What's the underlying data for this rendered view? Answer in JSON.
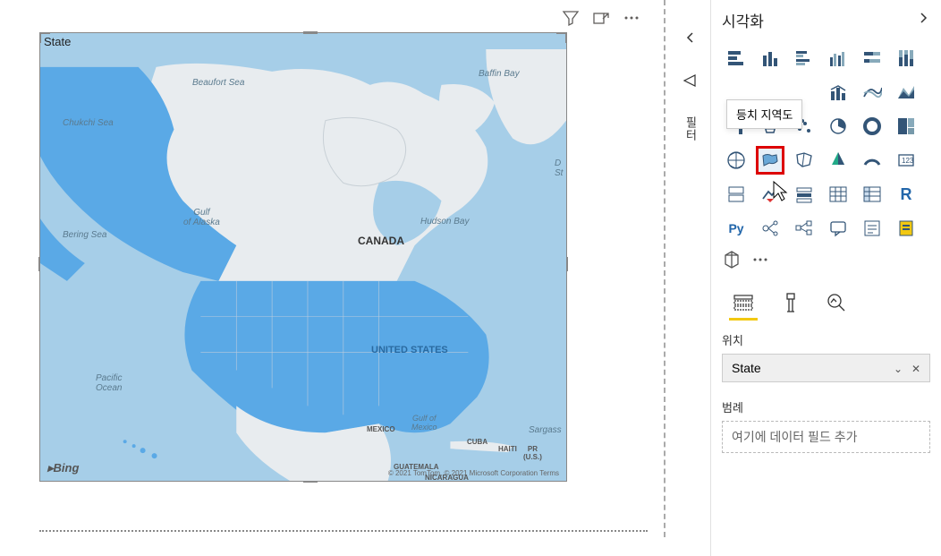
{
  "canvas": {
    "title_field": "State",
    "bing": "Bing",
    "copyright": "© 2021 TomTom, © 2021 Microsoft Corporation  Terms",
    "labels": {
      "beaufort": "Beaufort Sea",
      "baffin": "Baffin Bay",
      "chukchi": "Chukchi Sea",
      "hudson": "Hudson Bay",
      "bering": "Bering Sea",
      "gulf_alaska": "Gulf\nof Alaska",
      "pacific": "Pacific\nOcean",
      "canada": "CANADA",
      "us": "UNITED STATES",
      "mexico": "MEXICO",
      "gulf_mex": "Gulf of\nMexico",
      "cuba": "CUBA",
      "haiti": "HAITI",
      "pr": "PR\n(U.S.)",
      "guatemala": "GUATEMALA",
      "nicaragua": "NICARAGUA",
      "sargasso": "Sargass",
      "davis": "D\nSt"
    }
  },
  "collapsed": {
    "filters_label": "필터"
  },
  "panel": {
    "title": "시각화",
    "tooltip": "등치 지역도",
    "wells": {
      "location_label": "위치",
      "location_value": "State",
      "legend_label": "범례",
      "legend_placeholder": "여기에 데이터 필드 추가"
    },
    "viz_icons": [
      "stacked-bar",
      "stacked-col",
      "clustered-bar",
      "clustered-col",
      "100-bar",
      "100-col",
      "line",
      "area",
      "stacked-area",
      "line-col",
      "line-col2",
      "ribbon",
      "waterfall",
      "funnel",
      "scatter",
      "pie",
      "donut",
      "treemap",
      "map",
      "filled-map",
      "shape-map",
      "azure-map",
      "gauge",
      "card",
      "multi-card",
      "kpi",
      "slicer",
      "table",
      "matrix",
      "r",
      "py",
      "decomp",
      "keyinf",
      "qa",
      "narrative",
      "paginate"
    ]
  }
}
